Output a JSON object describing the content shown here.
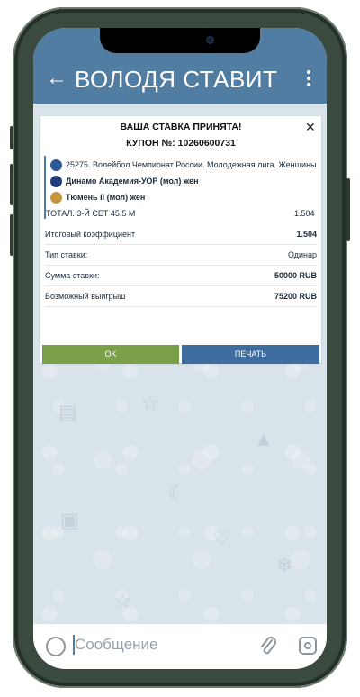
{
  "header": {
    "back_icon": "arrow-left-icon",
    "title": "ВОЛОДЯ СТАВИТ",
    "menu_icon": "more-vertical-icon",
    "color": "#517da2"
  },
  "bet_card": {
    "heading": "ВАША СТАВКА ПРИНЯТА!",
    "coupon": "КУПОН №: 10260600731",
    "close_icon": "close-icon",
    "event": {
      "league": "25275. Волейбол Чемпионат России. Молодежная лига. Женщины",
      "team1": "Динамо Академия-УОР (мол) жен",
      "team2": "Тюмень II (мол) жен",
      "market": "ТОТАЛ. 3-Й СЕТ 45.5 М",
      "odds": "1.504"
    },
    "summary": [
      {
        "label": "Итоговый коэффициент",
        "value": "1.504"
      },
      {
        "label": "Тип ставки:",
        "value": "Одинар"
      },
      {
        "label": "Сумма ставки:",
        "value": "50000 RUB"
      },
      {
        "label": "Возможный выигрыш",
        "value": "75200 RUB"
      }
    ],
    "ok_button": "OK",
    "print_button": "ПЕЧАТЬ",
    "ok_color": "#7aa04a",
    "print_color": "#3f6d9f"
  },
  "composer": {
    "placeholder": "Сообщение",
    "emoji_icon": "smile-icon",
    "attach_icon": "paperclip-icon",
    "camera_icon": "camera-icon"
  }
}
